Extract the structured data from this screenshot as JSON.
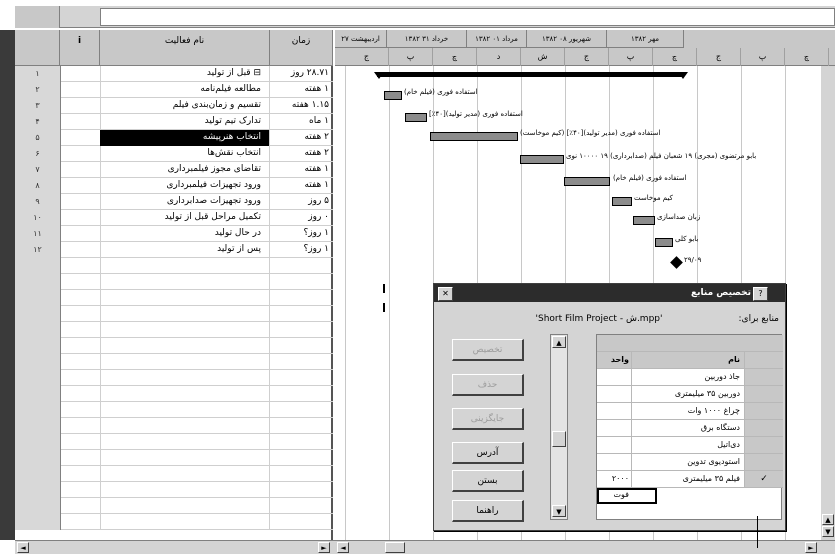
{
  "table": {
    "headers": {
      "info": "i",
      "name": "نام فعالیت",
      "duration": "زمان"
    },
    "rows": [
      {
        "id": "۱",
        "name": "⊟ قبل از تولید",
        "duration": "۲۸.۷۱ روز"
      },
      {
        "id": "۲",
        "name": "مطالعه فیلم‌نامه",
        "duration": "۱ هفته"
      },
      {
        "id": "۳",
        "name": "تقسیم و زمان‌بندی فیلم",
        "duration": "۱.۱۵ هفته"
      },
      {
        "id": "۴",
        "name": "تدارک تیم تولید",
        "duration": "۱ ماه"
      },
      {
        "id": "۵",
        "name": "انتخاب هنرپیشه",
        "duration": "۲ هفته",
        "selected": true
      },
      {
        "id": "۶",
        "name": "انتخاب نقش‌ها",
        "duration": "۲ هفته"
      },
      {
        "id": "۷",
        "name": "تقاضای مجوز فیلمبرداری",
        "duration": "۱ هفته"
      },
      {
        "id": "۸",
        "name": "ورود تجهیزات فیلمبرداری",
        "duration": "۱ هفته"
      },
      {
        "id": "۹",
        "name": "ورود تجهیزات صدابرداری",
        "duration": "۵ روز"
      },
      {
        "id": "۱۰",
        "name": "تکمیل مراحل قبل از تولید",
        "duration": "۰ روز"
      },
      {
        "id": "۱۱",
        "name": "در حال تولید",
        "duration": "۱ روز؟"
      },
      {
        "id": "۱۲",
        "name": "پس از تولید",
        "duration": "۱ روز؟"
      }
    ]
  },
  "gantt": {
    "weeks": [
      "۲۷ اردیبهشت",
      "۱۳۸۲ خرداد ۳۱",
      "۱۳۸۲ مرداد ۰۱",
      "۱۳۸۲ شهریور ۰۸",
      "۱۳۸۲ مهر"
    ],
    "days": [
      "ج",
      "پ",
      "چ",
      " د",
      "ش",
      "ج",
      "پ",
      "چ",
      "ج",
      "پ",
      "چ"
    ],
    "labels": [
      "استفاده فوری (فیلم خام)",
      "استفاده فوری (مدیر تولید)[۴۰٪]",
      "استفاده فوری (مدیر تولید)[۴۰٪] (کیم موخاست)",
      "بابو مرتضوی (مجری) ۱۹ شعبان فیلم (صدابرداری) ۱۹ ۱۰۰۰۰ نوی",
      "استفاده فوری (فیلم خام)",
      "کیم موخاست",
      "زبان صداسازی",
      "بابو کلی",
      "۲۹/۰۹"
    ]
  },
  "dialog": {
    "title": "تخصیص منابع",
    "help_btn": "?",
    "close_btn": "✕",
    "project_label": "منابع برای:",
    "project_name": "'Short Film Project - ش.mpp'",
    "buttons": [
      {
        "label": "تخصیص",
        "disabled": true
      },
      {
        "label": "حذف",
        "disabled": true
      },
      {
        "label": "جایگزینی",
        "disabled": true
      },
      {
        "label": "آدرس",
        "disabled": false
      },
      {
        "label": "بستن",
        "disabled": false
      },
      {
        "label": "راهنما",
        "disabled": false
      }
    ],
    "grid_headers": {
      "name": "نام",
      "units": "واحد"
    },
    "resources": [
      {
        "name": "جاذ دوربین",
        "units": "",
        "checked": false
      },
      {
        "name": "دوربین ۳۵ میلیمتری",
        "units": "",
        "checked": false
      },
      {
        "name": "چراغ ۱۰۰۰ وات",
        "units": "",
        "checked": false
      },
      {
        "name": "دستگاه برق",
        "units": "",
        "checked": false
      },
      {
        "name": "دی‌اتیل",
        "units": "",
        "checked": false
      },
      {
        "name": "استودیوی تدوین",
        "units": "",
        "checked": false
      },
      {
        "name": "فیلم ۳۵ میلیمتری",
        "units": "۲۰۰۰ فوت",
        "checked": true
      }
    ]
  },
  "scroll": {
    "up": "▲",
    "down": "▼",
    "left": "◄",
    "right": "►"
  }
}
